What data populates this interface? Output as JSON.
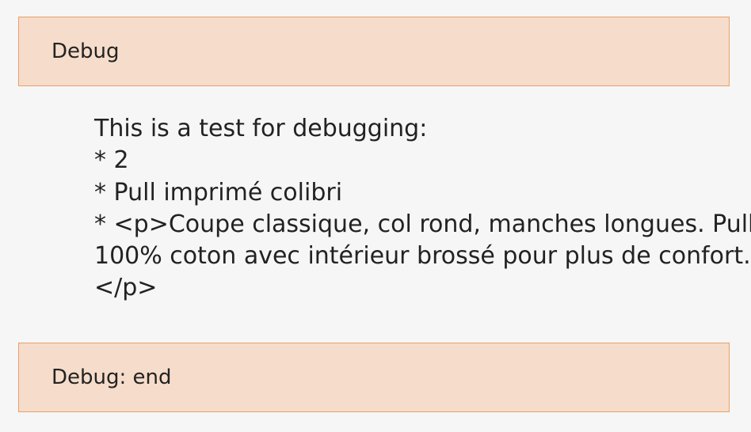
{
  "debug_start": {
    "label": "Debug"
  },
  "debug_content": {
    "lines": [
      "This is a test for debugging:",
      "* 2",
      "* Pull imprimé colibri",
      "* <p>Coupe classique, col rond, manches longues. Pull",
      "100% coton avec intérieur brossé pour plus de confort.",
      "</p>"
    ]
  },
  "debug_end": {
    "label": "Debug: end"
  }
}
